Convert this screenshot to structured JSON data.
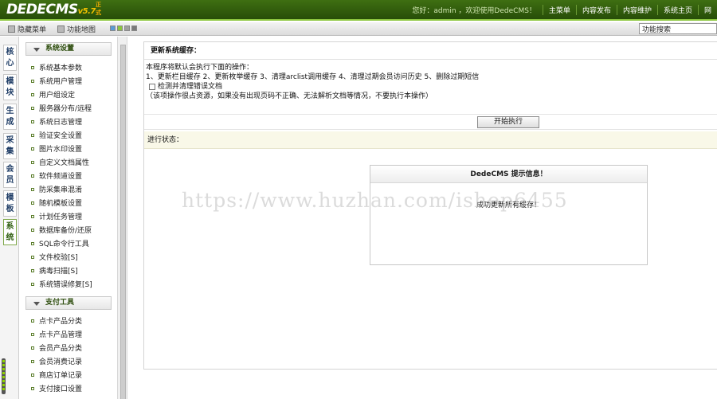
{
  "header": {
    "logo": "DEDECMS",
    "version": "v5.7",
    "badge": "正式",
    "greeting": "您好：admin ，欢迎使用DedeCMS！",
    "nav": [
      "主菜单",
      "内容发布",
      "内容维护",
      "系统主页",
      "网"
    ]
  },
  "toolbar": {
    "hide_menu": "隐藏菜单",
    "site_map": "功能地图",
    "swatch_colors": [
      "#5b9bd5",
      "#8cc63f",
      "#a0a0a0",
      "#7a7a7a"
    ],
    "search_value": "功能搜索"
  },
  "vtabs": [
    {
      "label": [
        "核",
        "心"
      ]
    },
    {
      "label": [
        "模",
        "块"
      ]
    },
    {
      "label": [
        "生",
        "成"
      ]
    },
    {
      "label": [
        "采",
        "集"
      ]
    },
    {
      "label": [
        "会",
        "员"
      ]
    },
    {
      "label": [
        "模",
        "板"
      ]
    },
    {
      "label": [
        "系",
        "统"
      ]
    }
  ],
  "menu": {
    "group1": {
      "title": "系统设置",
      "items": [
        "系统基本参数",
        "系统用户管理",
        "用户组设定",
        "服务器分布/远程",
        "系统日志管理",
        "验证安全设置",
        "图片水印设置",
        "自定义文档属性",
        "软件频道设置",
        "防采集串混淆",
        "随机模板设置",
        "计划任务管理",
        "数据库备份/还原",
        "SQL命令行工具",
        "文件校验[S]",
        "病毒扫描[S]",
        "系统错误修复[S]"
      ]
    },
    "group2": {
      "title": "支付工具",
      "items": [
        "点卡产品分类",
        "点卡产品管理",
        "会员产品分类",
        "会员消费记录",
        "商店订单记录",
        "支付接口设置"
      ]
    }
  },
  "main": {
    "title": "更新系统缓存：",
    "intro": "本程序将默认会执行下面的操作：",
    "steps": "1、更新栏目缓存 2、更新枚举缓存 3、清理arclist调用缓存 4、清理过期会员访问历史 5、删除过期短信",
    "checkbox_label": "检测并清理错误文档",
    "note": "（该项操作很占资源，如果没有出现页码不正确、无法解析文档等情况，不要执行本操作）",
    "run_button": "开始执行",
    "status_label": "进行状态："
  },
  "dialog": {
    "title": "DedeCMS 提示信息！",
    "message": "成功更新所有缓存！"
  },
  "watermark": "https://www.huzhan.com/ishop6455"
}
